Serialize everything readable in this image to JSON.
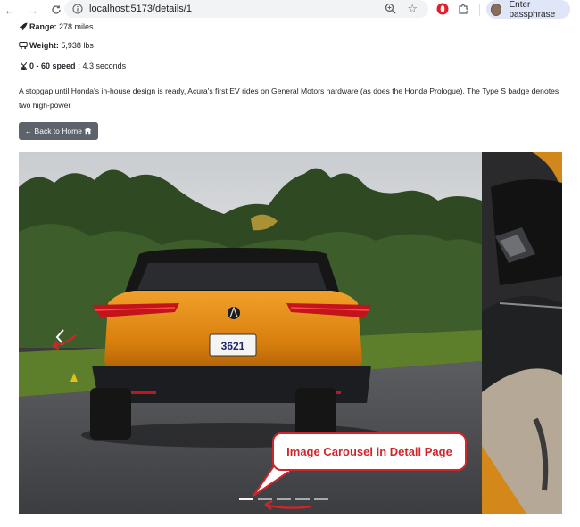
{
  "browser": {
    "url": "localhost:5173/details/1",
    "profile_label": "Enter passphrase"
  },
  "specs": [
    {
      "label": "Range:",
      "value": "278 miles",
      "icon": "rocket-icon"
    },
    {
      "label": "Weight:",
      "value": "5,938 lbs",
      "icon": "truck-icon"
    },
    {
      "label": "0 - 60 speed :",
      "value": "4.3 seconds",
      "icon": "hourglass-icon"
    }
  ],
  "description": "A stopgap until Honda's in-house design is ready, Acura's first EV rides on General Motors hardware (as does the Honda Prologue). The Type S badge denotes two high-power",
  "back_button": {
    "label": "← Back to Home",
    "icon": "home-icon"
  },
  "carousel": {
    "plate_text": "3621",
    "indicator_count": 5,
    "active_index": 0
  },
  "annotation": {
    "text": "Image Carousel in Detail Page"
  },
  "colors": {
    "button_bg": "#5c636a",
    "annotation_red": "#d0252b",
    "car_orange": "#e08a12",
    "profile_chip": "#dfe6f7"
  }
}
